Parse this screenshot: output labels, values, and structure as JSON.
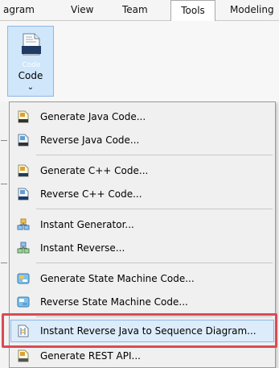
{
  "menubar": {
    "tabs": [
      {
        "label": "agram",
        "active": false
      },
      {
        "label": "View",
        "active": false
      },
      {
        "label": "Team",
        "active": false
      },
      {
        "label": "Tools",
        "active": true
      },
      {
        "label": "Modeling",
        "active": false
      }
    ]
  },
  "ribbon": {
    "code_button": {
      "icon_text": "Code",
      "label": "Code",
      "chevron": "⌄",
      "icon": "code-file-icon"
    }
  },
  "menu": {
    "items": [
      {
        "label": "Generate Java Code...",
        "icon": "java-generate-icon"
      },
      {
        "label": "Reverse Java Code...",
        "icon": "java-reverse-icon"
      },
      {
        "label": "Generate C++ Code...",
        "icon": "cpp-generate-icon"
      },
      {
        "label": "Reverse C++ Code...",
        "icon": "cpp-reverse-icon"
      },
      {
        "label": "Instant Generator...",
        "icon": "instant-generator-icon"
      },
      {
        "label": "Instant Reverse...",
        "icon": "instant-reverse-icon"
      },
      {
        "label": "Generate State Machine Code...",
        "icon": "state-machine-generate-icon"
      },
      {
        "label": "Reverse State Machine Code...",
        "icon": "state-machine-reverse-icon"
      },
      {
        "label": "Instant Reverse Java to Sequence Diagram...",
        "icon": "sequence-diagram-icon",
        "highlighted": true
      },
      {
        "label": "Generate REST API...",
        "icon": "rest-api-icon"
      }
    ]
  },
  "colors": {
    "highlight_border": "#d94b55",
    "selected_bg": "#cfe6fb"
  }
}
